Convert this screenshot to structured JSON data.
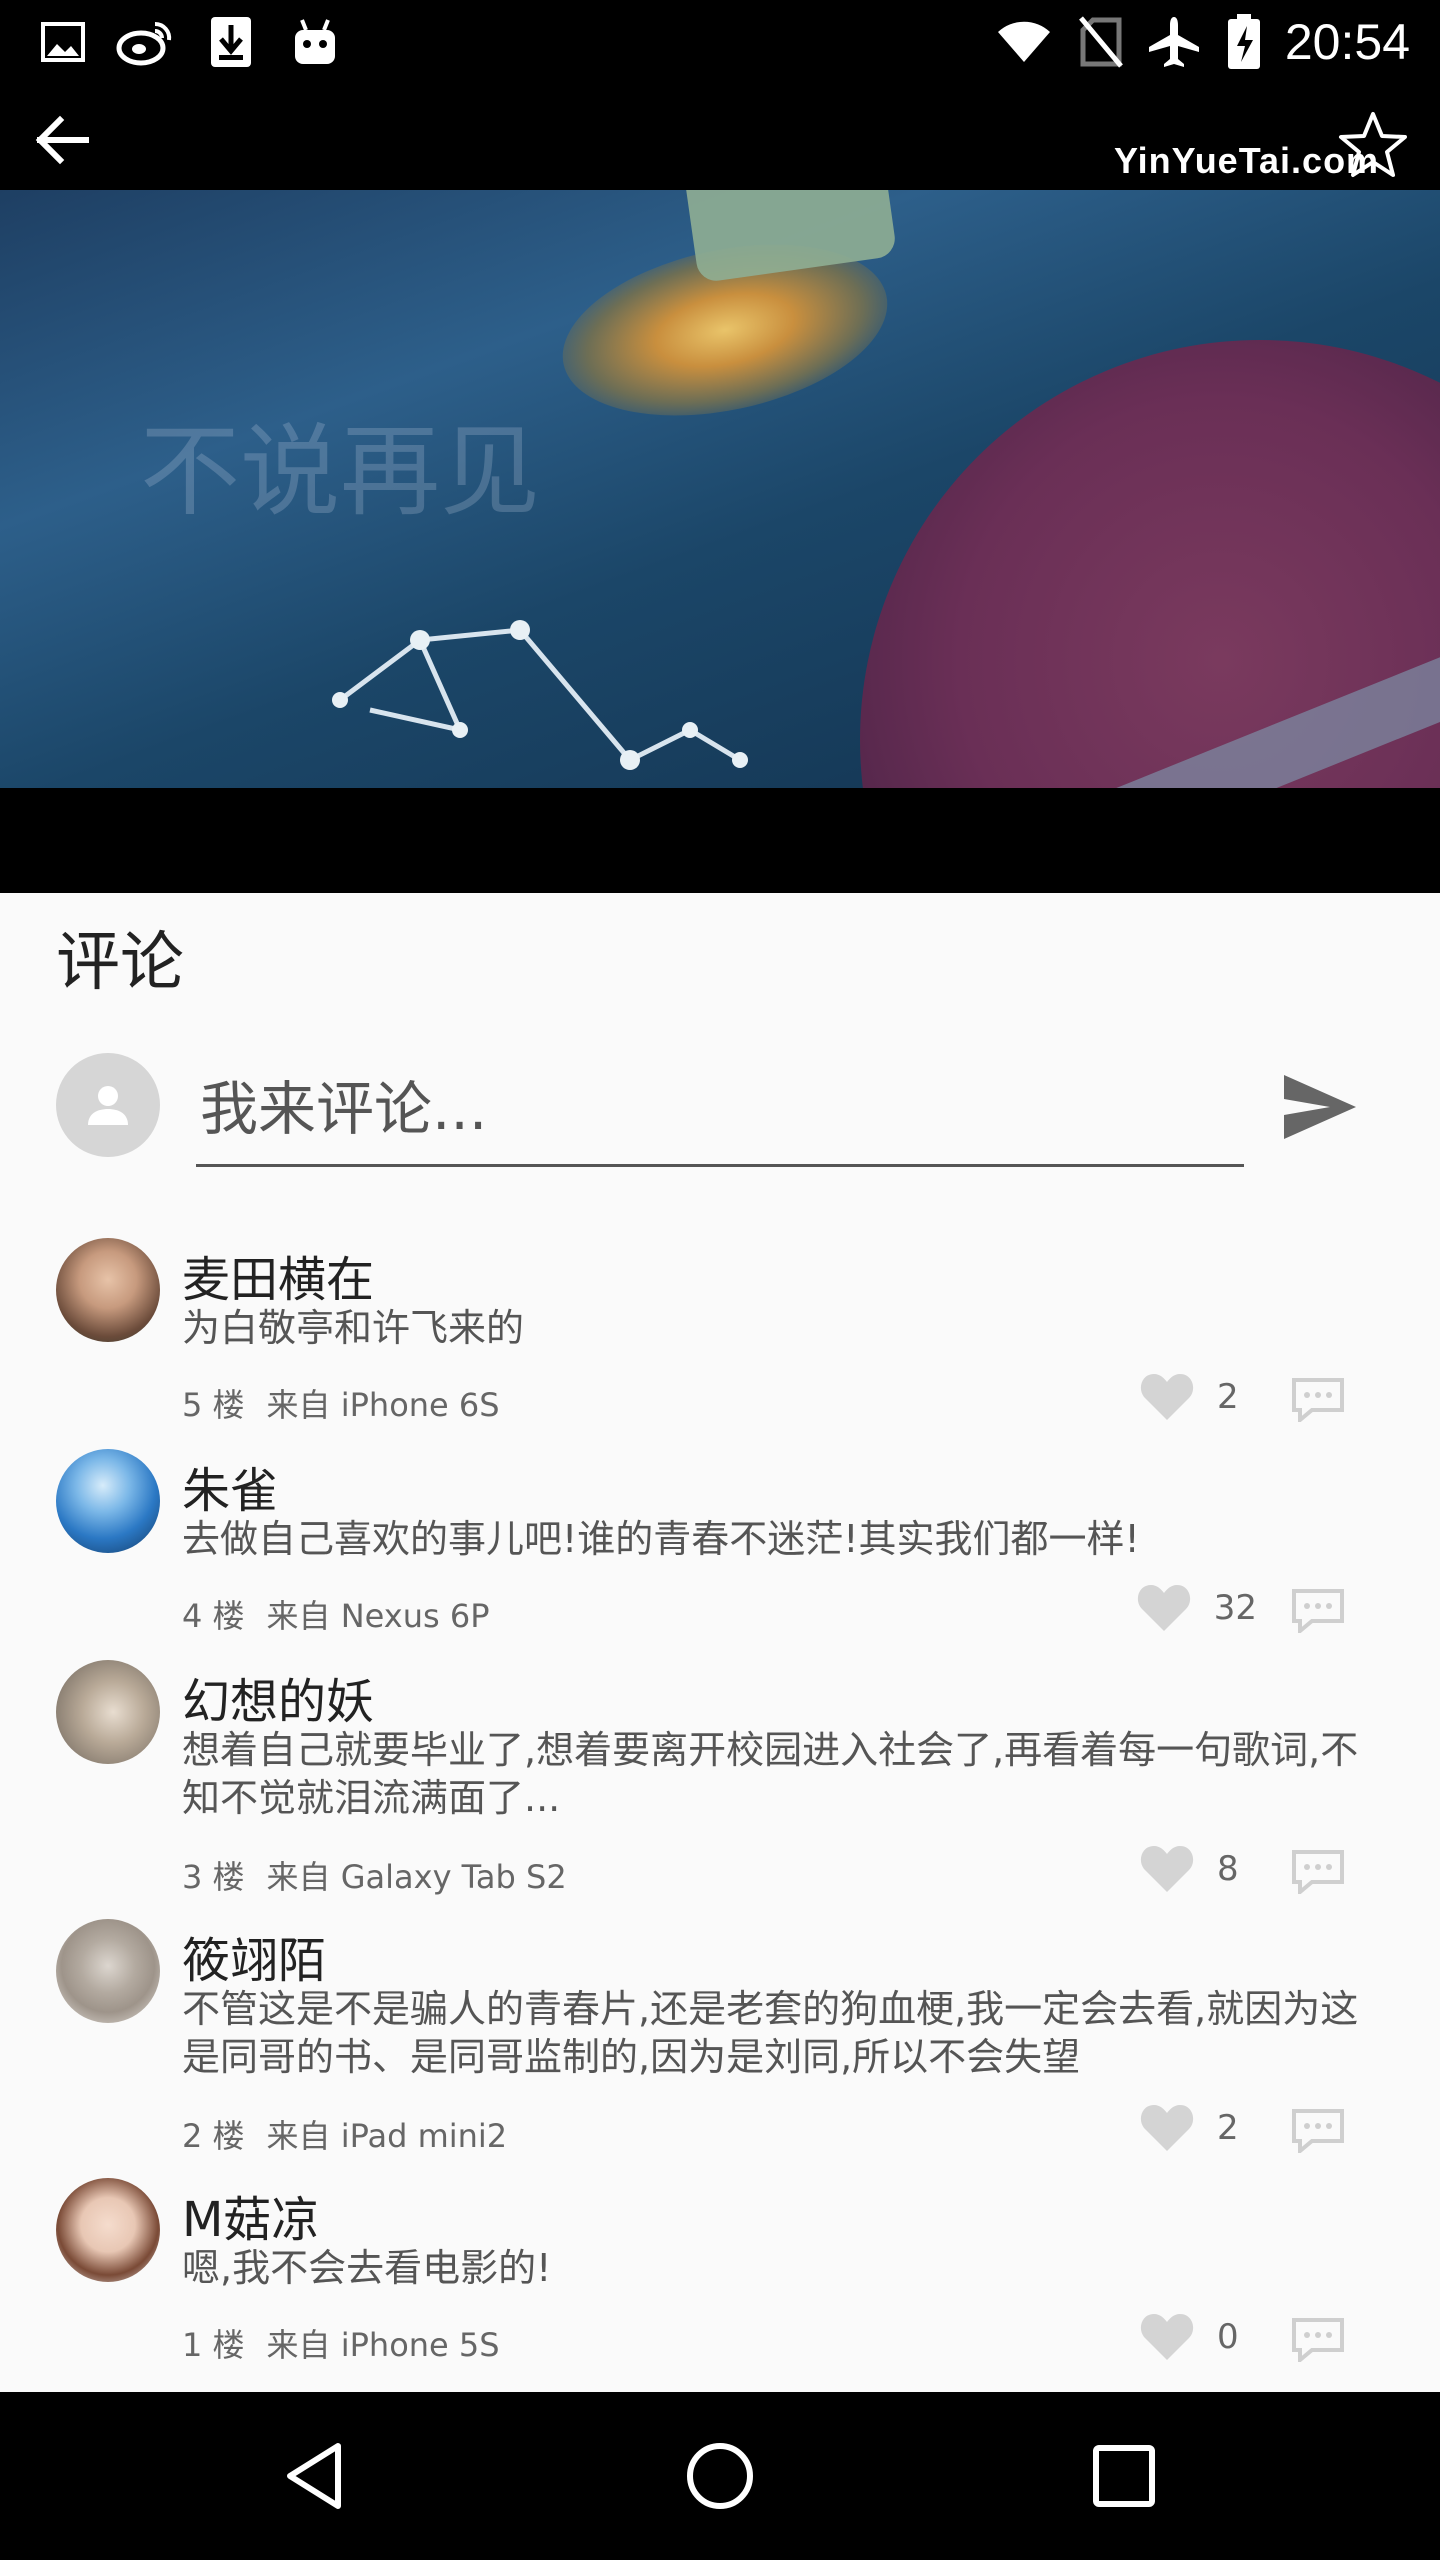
{
  "status_bar": {
    "time": "20:54",
    "left_icons": [
      "gallery-icon",
      "weibo-icon",
      "download-icon",
      "android-icon"
    ],
    "right_icons": [
      "wifi-icon",
      "no-sim-icon",
      "airplane-mode-icon",
      "battery-charging-icon"
    ]
  },
  "video": {
    "watermark": "YinYueTai.com",
    "overlay_text": "不说再见"
  },
  "comments_section": {
    "title": "评论",
    "input_placeholder": "我来评论...",
    "items": [
      {
        "name": "麦田横在",
        "text": "为白敬亭和许飞来的",
        "floor": "5 楼",
        "source": "来自 iPhone 6S",
        "likes": "2",
        "avatar_color": "#6b4b3a"
      },
      {
        "name": "朱雀",
        "text": "去做自己喜欢的事儿吧!谁的青春不迷茫!其实我们都一样!",
        "floor": "4 楼",
        "source": "来自 Nexus 6P",
        "likes": "32",
        "avatar_color": "#2b78c4"
      },
      {
        "name": "幻想的妖",
        "text": "想着自己就要毕业了,想着要离开校园进入社会了,再看着每一句歌词,不知不觉就泪流满面了...",
        "floor": "3 楼",
        "source": "来自 Galaxy Tab S2",
        "likes": "8",
        "avatar_color": "#b9aa98"
      },
      {
        "name": "筱翊陌",
        "text": "不管这是不是骗人的青春片,还是老套的狗血梗,我一定会去看,就因为这是同哥的书、是同哥监制的,因为是刘同,所以不会失望",
        "floor": "2 楼",
        "source": "来自 iPad mini2",
        "likes": "2",
        "avatar_color": "#9e948a"
      },
      {
        "name": "M菇凉",
        "text": "嗯,我不会去看电影的!",
        "floor": "1 楼",
        "source": "来自 iPhone 5S",
        "likes": "0",
        "avatar_color": "#e8c7b4"
      }
    ]
  },
  "nav_bar": {
    "buttons": [
      "back-nav-icon",
      "home-nav-icon",
      "recents-nav-icon"
    ]
  }
}
